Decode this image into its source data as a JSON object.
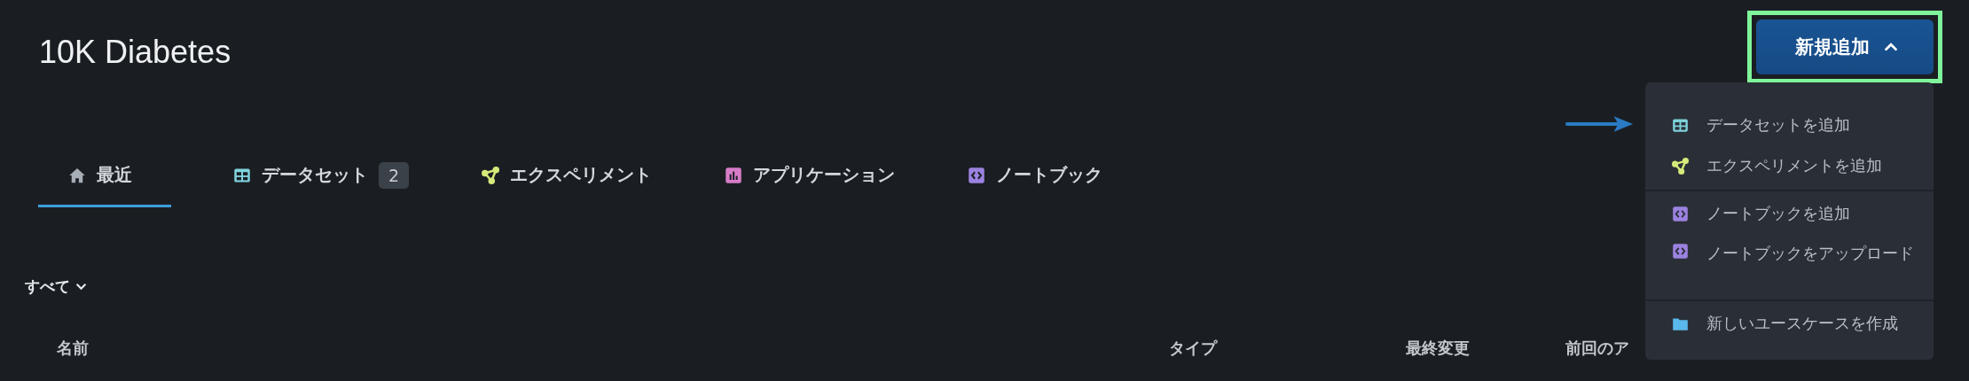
{
  "title": "10K Diabetes",
  "add_button": {
    "label": "新規追加",
    "expanded": true,
    "highlighted": true
  },
  "menu_arrow": true,
  "menu": [
    {
      "kind": "dataset",
      "label": "データセットを追加",
      "divider_before": false
    },
    {
      "kind": "experiment",
      "label": "エクスペリメントを追加",
      "divider_before": false
    },
    {
      "kind": "notebook",
      "label": "ノートブックを追加",
      "divider_before": true
    },
    {
      "kind": "notebook",
      "label": "ノートブックをアップロード",
      "divider_before": false
    },
    {
      "kind": "folder",
      "label": "新しいユースケースを作成",
      "divider_before": true
    }
  ],
  "tabs": [
    {
      "kind": "home",
      "label": "最近",
      "selected": true
    },
    {
      "kind": "dataset",
      "label": "データセット",
      "count": "2",
      "selected": false
    },
    {
      "kind": "experiment",
      "label": "エクスペリメント",
      "selected": false
    },
    {
      "kind": "app",
      "label": "アプリケーション",
      "selected": false
    },
    {
      "kind": "notebook",
      "label": "ノートブック",
      "selected": false
    }
  ],
  "filter": {
    "label": "すべて"
  },
  "columns": [
    "名前",
    "タイプ",
    "最終変更",
    "前回のア"
  ]
}
